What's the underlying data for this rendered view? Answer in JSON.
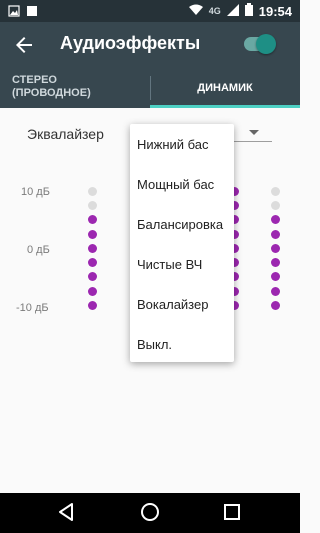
{
  "status_bar": {
    "network": "4G",
    "time": "19:54"
  },
  "toolbar": {
    "title": "Аудиоэффекты",
    "toggle_on": true
  },
  "tabs": [
    {
      "label": "СТЕРЕО\n(ПРОВОДНОЕ)"
    },
    {
      "label": "ДИНАМИК",
      "selected": true
    }
  ],
  "equalizer": {
    "label": "Эквалайзер",
    "db_labels": [
      "10 дБ",
      "0 дБ",
      "-10 дБ"
    ]
  },
  "dropdown": {
    "items": [
      "Нижний бас",
      "Мощный бас",
      "Балансировка",
      "Чистые ВЧ",
      "Вокалайзер",
      "Выкл."
    ]
  },
  "colors": {
    "accent": "#1e8f85",
    "toolbar": "#37474f",
    "status_bar": "#263238",
    "eq_dot_on": "#9c27b0",
    "eq_dot_off": "#dcdcdc"
  }
}
